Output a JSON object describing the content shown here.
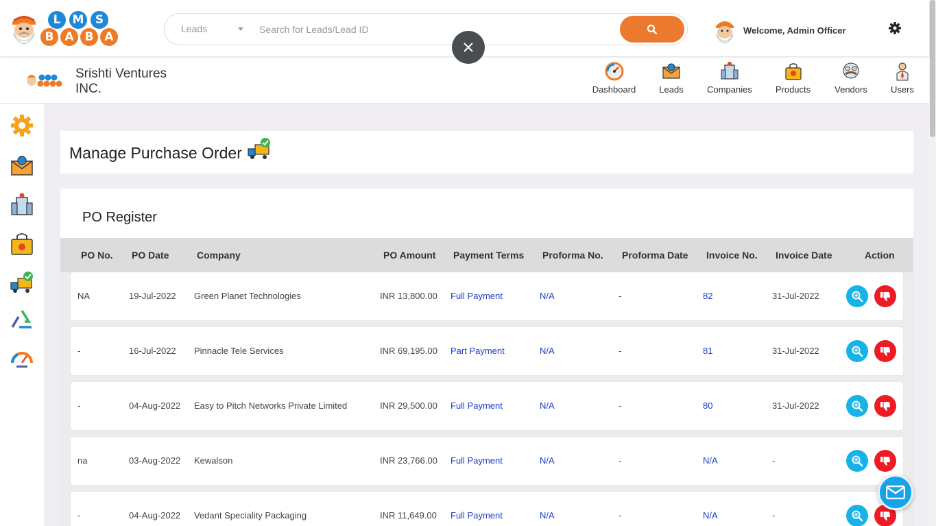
{
  "header": {
    "logo_letters": {
      "top": [
        "L",
        "M",
        "S"
      ],
      "bottom": [
        "B",
        "A",
        "B",
        "A"
      ]
    },
    "search": {
      "category": "Leads",
      "placeholder": "Search for Leads/Lead ID",
      "value": ""
    },
    "welcome": "Welcome, Admin Officer"
  },
  "subheader": {
    "company_name": "Srishti Ventures INC.",
    "nav": [
      {
        "label": "Dashboard",
        "icon": "dashboard-gauge-icon"
      },
      {
        "label": "Leads",
        "icon": "leads-envelope-icon"
      },
      {
        "label": "Companies",
        "icon": "companies-building-icon"
      },
      {
        "label": "Products",
        "icon": "products-bag-icon"
      },
      {
        "label": "Vendors",
        "icon": "vendors-handshake-icon"
      },
      {
        "label": "Users",
        "icon": "users-person-icon"
      }
    ]
  },
  "sidebar": {
    "icons": [
      "settings-gear-icon",
      "leads-envelope-icon",
      "companies-building-icon",
      "products-bag-icon",
      "purchase-order-truck-icon",
      "recycle-icon",
      "dashboard-gauge-icon"
    ]
  },
  "page": {
    "title": "Manage Purchase Order",
    "card_heading": "PO Register"
  },
  "table": {
    "columns": [
      "PO No.",
      "PO Date",
      "Company",
      "PO Amount",
      "Payment Terms",
      "Proforma No.",
      "Proforma Date",
      "Invoice No.",
      "Invoice Date",
      "Action"
    ],
    "rows": [
      {
        "po_no": "NA",
        "po_date": "19-Jul-2022",
        "company": "Green Planet Technologies",
        "amount": "INR 13,800.00",
        "terms": "Full Payment",
        "proforma_no": "N/A",
        "proforma_date": "-",
        "invoice_no": "82",
        "invoice_date": "31-Jul-2022"
      },
      {
        "po_no": "-",
        "po_date": "16-Jul-2022",
        "company": "Pinnacle Tele Services",
        "amount": "INR 69,195.00",
        "terms": "Part Payment",
        "proforma_no": "N/A",
        "proforma_date": "-",
        "invoice_no": "81",
        "invoice_date": "31-Jul-2022"
      },
      {
        "po_no": "-",
        "po_date": "04-Aug-2022",
        "company": "Easy to Pitch Networks Private Limited",
        "amount": "INR 29,500.00",
        "terms": "Full Payment",
        "proforma_no": "N/A",
        "proforma_date": "-",
        "invoice_no": "80",
        "invoice_date": "31-Jul-2022"
      },
      {
        "po_no": "na",
        "po_date": "03-Aug-2022",
        "company": "Kewalson",
        "amount": "INR 23,766.00",
        "terms": "Full Payment",
        "proforma_no": "N/A",
        "proforma_date": "-",
        "invoice_no": "N/A",
        "invoice_date": "-"
      },
      {
        "po_no": "-",
        "po_date": "04-Aug-2022",
        "company": "Vedant Speciality Packaging",
        "amount": "INR 11,649.00",
        "terms": "Full Payment",
        "proforma_no": "N/A",
        "proforma_date": "-",
        "invoice_no": "N/A",
        "invoice_date": "-"
      }
    ]
  },
  "colors": {
    "accent_orange": "#ec7a2e",
    "view_blue": "#16b3e8",
    "reject_red": "#ee1b24",
    "link_blue": "#1f3fc6"
  }
}
